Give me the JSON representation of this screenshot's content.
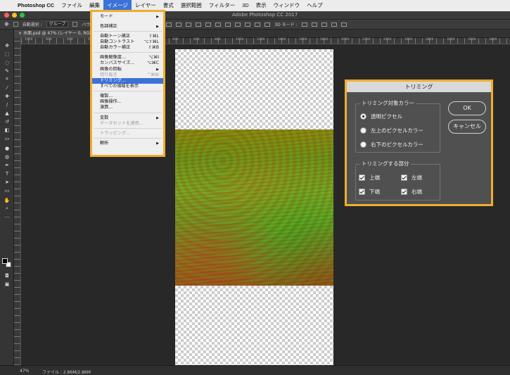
{
  "menubar": {
    "items": [
      {
        "label": "Photoshop CC"
      },
      {
        "label": "ファイル"
      },
      {
        "label": "編集"
      },
      {
        "label": "イメージ"
      },
      {
        "label": "レイヤー"
      },
      {
        "label": "書式"
      },
      {
        "label": "選択範囲"
      },
      {
        "label": "フィルター"
      },
      {
        "label": "3D"
      },
      {
        "label": "表示"
      },
      {
        "label": "ウィンドウ"
      },
      {
        "label": "ヘルプ"
      }
    ]
  },
  "window": {
    "title": "Adobe Photoshop CC 2017"
  },
  "options": {
    "auto_select_label": "自動選択 :",
    "group_value": "グループ",
    "transform_label": "バウンデ",
    "mode_3d": "3D モード :"
  },
  "tab": {
    "label": "水面.psd @ 47% (レイヤー 0, RGB/8#)"
  },
  "ruler": {
    "top_numbers": [
      "1000",
      "800",
      "600",
      "400",
      "200",
      "0",
      "200",
      "400",
      "600",
      "800",
      "1000",
      "1200",
      "1400",
      "1600",
      "1800",
      "2000",
      "2200",
      "2400",
      "2600",
      "2800",
      "3000",
      "3200",
      "3400"
    ]
  },
  "status": {
    "zoom": "47%",
    "file": "ファイル : 2.86M/2.86M"
  },
  "image_menu": {
    "items": [
      {
        "label": "モード",
        "submenu": true
      },
      {
        "label": "色調補正",
        "submenu": true
      },
      {
        "label": "自動トーン補正",
        "shortcut": "⇧⌘L"
      },
      {
        "label": "自動コントラスト",
        "shortcut": "⌥⇧⌘L"
      },
      {
        "label": "自動カラー補正",
        "shortcut": "⇧⌘B"
      },
      {
        "label": "画像解像度...",
        "shortcut": "⌥⌘I"
      },
      {
        "label": "カンバスサイズ...",
        "shortcut": "⌥⌘C"
      },
      {
        "label": "画像の回転",
        "submenu": true
      },
      {
        "label": "切り抜き",
        "shortcut": "^⌘W",
        "disabled": true
      },
      {
        "label": "トリミング...",
        "highlighted": true
      },
      {
        "label": "すべての領域を表示"
      },
      {
        "label": "複製..."
      },
      {
        "label": "画像操作..."
      },
      {
        "label": "演算..."
      },
      {
        "label": "変数",
        "submenu": true
      },
      {
        "label": "データセットを適用...",
        "disabled": true
      },
      {
        "label": "トラッピング...",
        "disabled": true
      },
      {
        "label": "解析",
        "submenu": true
      }
    ]
  },
  "trim_dialog": {
    "title": "トリミング",
    "based_on_label": "トリミング対象カラー",
    "options": [
      "透明ピクセル",
      "左上のピクセルカラー",
      "右下のピクセルカラー"
    ],
    "selected_option": 0,
    "trim_away_label": "トリミングする部分",
    "checks": [
      "上端",
      "左端",
      "下端",
      "右端"
    ],
    "ok": "OK",
    "cancel": "キャンセル"
  },
  "colors": {
    "menu_highlight": "#3b72d9",
    "highlight_frame": "#f0ad2e",
    "panel_bg": "#505050"
  }
}
